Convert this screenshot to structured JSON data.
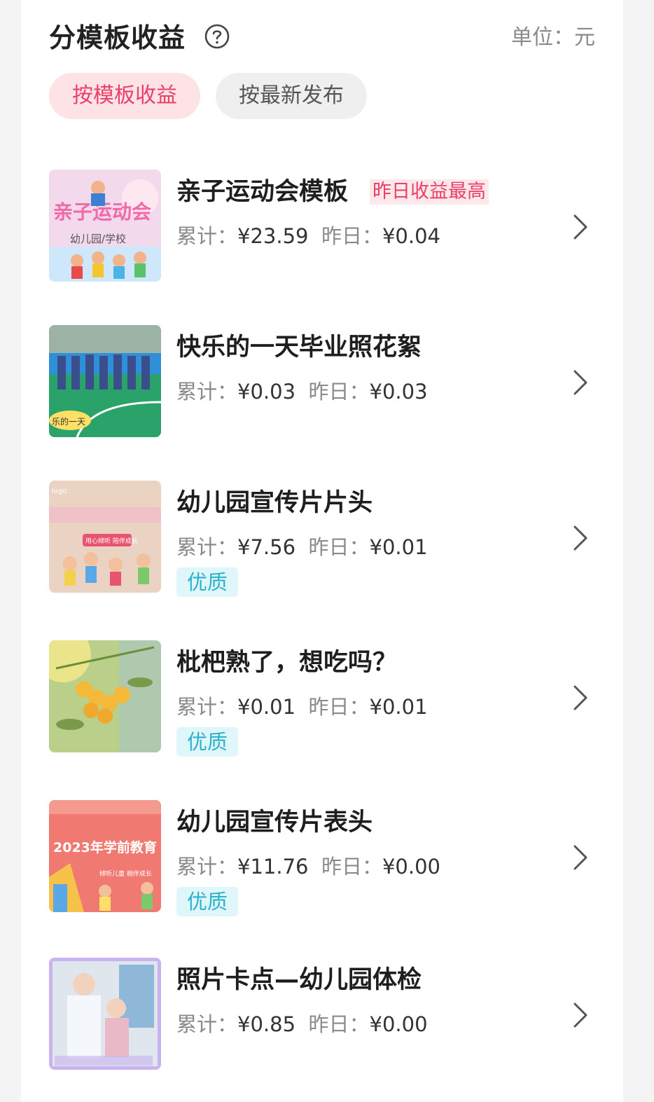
{
  "header": {
    "title": "分模板收益",
    "unit": "单位：元"
  },
  "tabs": [
    {
      "label": "按模板收益",
      "active": true
    },
    {
      "label": "按最新发布",
      "active": false
    }
  ],
  "stat_labels": {
    "total": "累计：",
    "yesterday": "昨日："
  },
  "items": [
    {
      "title": "亲子运动会模板",
      "badge": "昨日收益最高",
      "total": "¥23.59",
      "yesterday": "¥0.04",
      "quality": ""
    },
    {
      "title": "快乐的一天毕业照花絮",
      "badge": "",
      "total": "¥0.03",
      "yesterday": "¥0.03",
      "quality": ""
    },
    {
      "title": "幼儿园宣传片片头",
      "badge": "",
      "total": "¥7.56",
      "yesterday": "¥0.01",
      "quality": "优质"
    },
    {
      "title": "枇杷熟了，想吃吗？",
      "badge": "",
      "total": "¥0.01",
      "yesterday": "¥0.01",
      "quality": "优质"
    },
    {
      "title": "幼儿园宣传片表头",
      "badge": "",
      "total": "¥11.76",
      "yesterday": "¥0.00",
      "quality": "优质"
    },
    {
      "title": "照片卡点—幼儿园体检",
      "badge": "",
      "total": "¥0.85",
      "yesterday": "¥0.00",
      "quality": ""
    }
  ],
  "thumb_texts": {
    "t1_a": "亲子运动会",
    "t1_b": "幼儿园/学校",
    "t3_a": "logo",
    "t3_b": "用心倾听 陪伴成长",
    "t5_a": "2023年学前教育",
    "t5_b": "倾听儿童 相伴成长",
    "t2_a": "乐的一天"
  },
  "colors": {
    "accent": "#e8406a",
    "quality": "#2db2c9"
  }
}
